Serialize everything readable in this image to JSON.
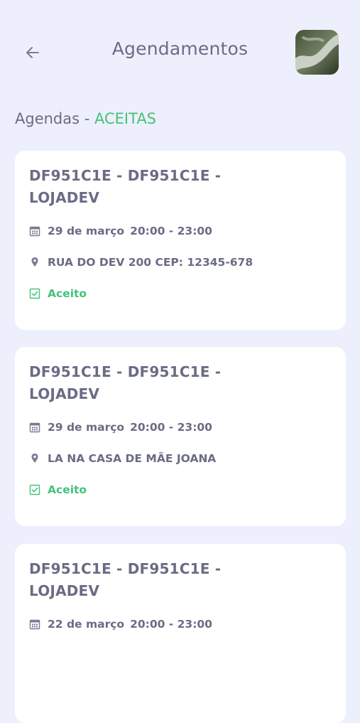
{
  "header": {
    "title": "Agendamentos"
  },
  "section": {
    "prefix": "Agendas - ",
    "accent": "ACEITAS"
  },
  "colors": {
    "background": "#eeeffd",
    "text": "#6a6c85",
    "accent_green": "#45c27a",
    "card": "#ffffff"
  },
  "cards": [
    {
      "title": "DF951C1E - DF951C1E - LOJADEV",
      "date": "29 de março",
      "time": "20:00 - 23:00",
      "address": "RUA DO DEV 200 CEP: 12345-678",
      "status": "Aceito"
    },
    {
      "title": "DF951C1E - DF951C1E - LOJADEV",
      "date": "29 de março",
      "time": "20:00 - 23:00",
      "address": "LA NA CASA DE MÃE JOANA",
      "status": "Aceito"
    },
    {
      "title": "DF951C1E - DF951C1E - LOJADEV",
      "date": "22 de março",
      "time": "20:00 - 23:00"
    }
  ]
}
